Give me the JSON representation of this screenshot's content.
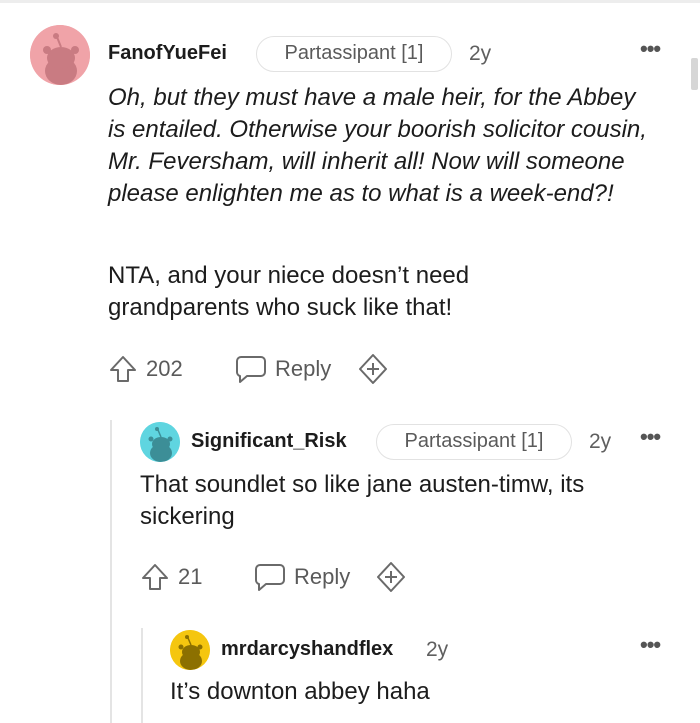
{
  "comments": [
    {
      "username": "FanofYueFei",
      "flair": "Partassipant [1]",
      "age": "2y",
      "avatar": "pink-snoo-avatar",
      "body_italic": "Oh, but they must have a male heir, for the Abbey is entailed. Otherwise your boorish solicitor cousin, Mr. Feversham, will inherit all! Now will someone please enlighten me as to what is a week-end?!",
      "body": "NTA, and your niece doesn’t need grandparents who suck like that!",
      "upvotes": "202",
      "reply_label": "Reply"
    },
    {
      "username": "Significant_Risk",
      "flair": "Partassipant [1]",
      "age": "2y",
      "avatar": "teal-snoo-avatar",
      "body": "That soundlet so like jane austen-timw, its sickering",
      "upvotes": "21",
      "reply_label": "Reply"
    },
    {
      "username": "mrdarcyshandflex",
      "age": "2y",
      "avatar": "yellow-snoo-avatar",
      "body": "It’s downton abbey haha"
    }
  ],
  "colors": {
    "avatar_pink": "#f0a3a8",
    "avatar_teal": "#5fd5e0",
    "avatar_yellow": "#f5c60f",
    "text": "#1c1c1c",
    "muted": "#5a5a5a"
  }
}
